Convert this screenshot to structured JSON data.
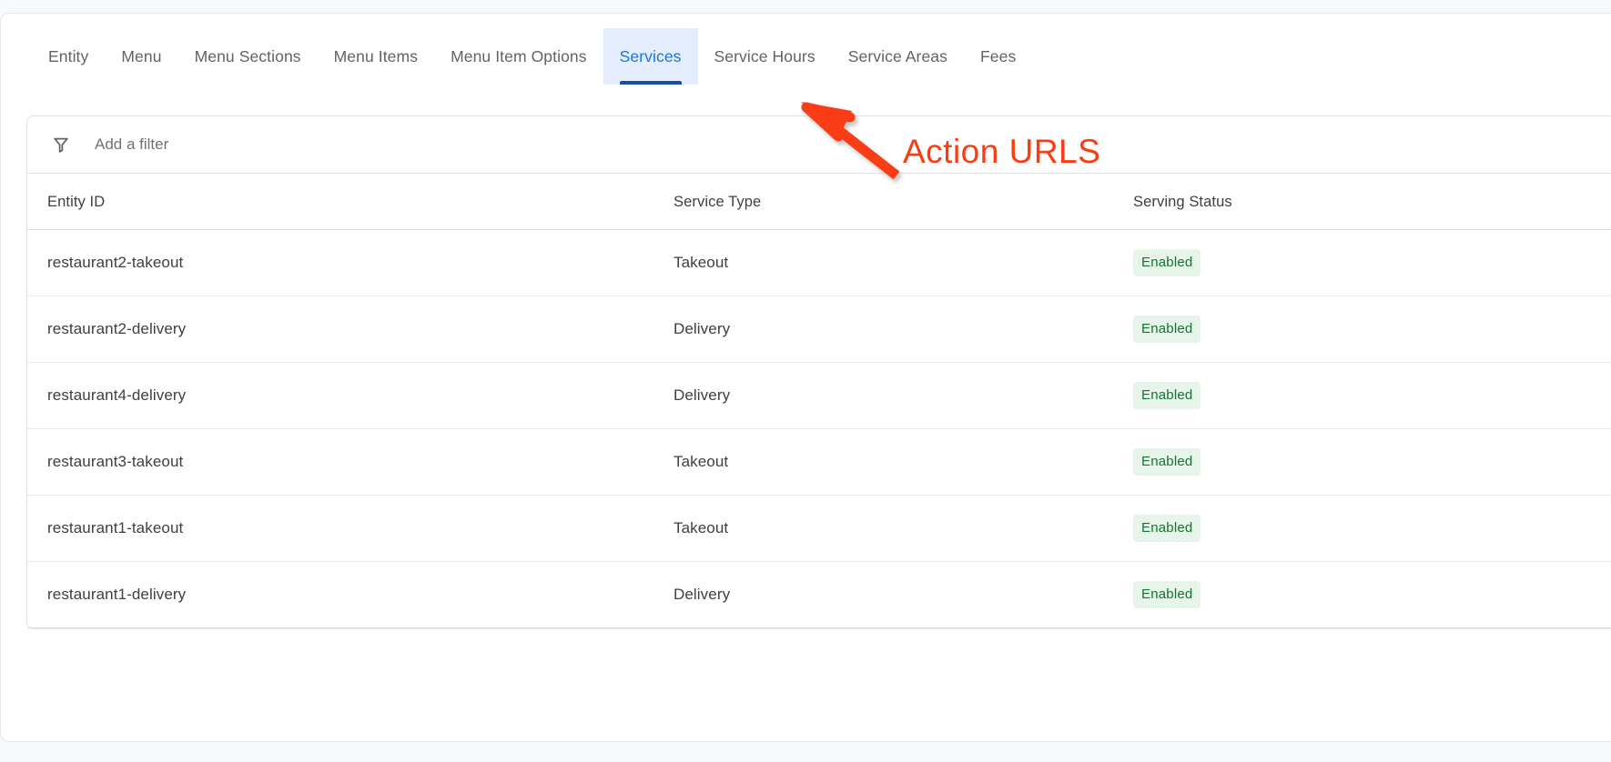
{
  "tabs": [
    {
      "label": "Entity",
      "active": false
    },
    {
      "label": "Menu",
      "active": false
    },
    {
      "label": "Menu Sections",
      "active": false
    },
    {
      "label": "Menu Items",
      "active": false
    },
    {
      "label": "Menu Item Options",
      "active": false
    },
    {
      "label": "Services",
      "active": true
    },
    {
      "label": "Service Hours",
      "active": false
    },
    {
      "label": "Service Areas",
      "active": false
    },
    {
      "label": "Fees",
      "active": false
    }
  ],
  "filter": {
    "icon": "filter-funnel-icon",
    "value": "",
    "placeholder": "Add a filter"
  },
  "table": {
    "columns": [
      "Entity ID",
      "Service Type",
      "Serving Status"
    ],
    "rows": [
      {
        "entity_id": "restaurant2-takeout",
        "service_type": "Takeout",
        "serving_status": "Enabled"
      },
      {
        "entity_id": "restaurant2-delivery",
        "service_type": "Delivery",
        "serving_status": "Enabled"
      },
      {
        "entity_id": "restaurant4-delivery",
        "service_type": "Delivery",
        "serving_status": "Enabled"
      },
      {
        "entity_id": "restaurant3-takeout",
        "service_type": "Takeout",
        "serving_status": "Enabled"
      },
      {
        "entity_id": "restaurant1-takeout",
        "service_type": "Takeout",
        "serving_status": "Enabled"
      },
      {
        "entity_id": "restaurant1-delivery",
        "service_type": "Delivery",
        "serving_status": "Enabled"
      }
    ]
  },
  "annotation": {
    "text": "Action URLS",
    "color": "#f93c13",
    "arrow": "red-arrow-up-left"
  },
  "colors": {
    "accent": "#1a73e8",
    "active_tab_bg": "#e3edfd",
    "active_tab_underline": "#174ea6",
    "chip_bg": "#e6f4ea",
    "chip_text": "#137333",
    "annotation": "#f93c13"
  }
}
